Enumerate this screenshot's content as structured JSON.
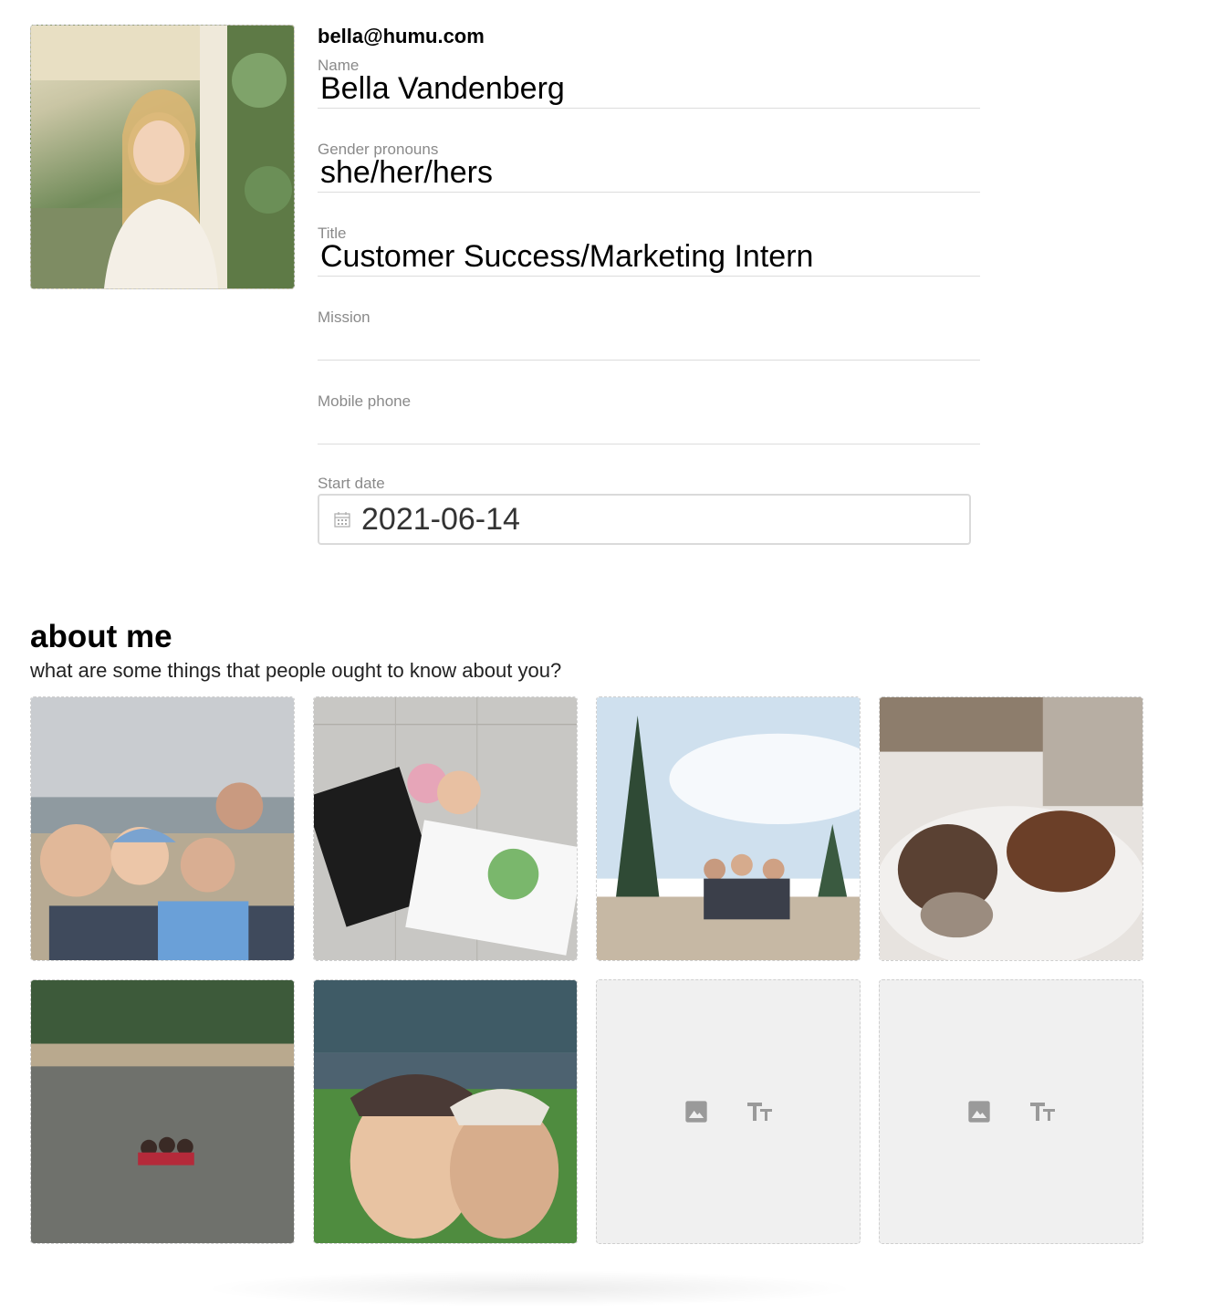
{
  "profile": {
    "email": "bella@humu.com",
    "fields": {
      "name": {
        "label": "Name",
        "value": "Bella Vandenberg"
      },
      "pronouns": {
        "label": "Gender pronouns",
        "value": "she/her/hers"
      },
      "title": {
        "label": "Title",
        "value": "Customer Success/Marketing Intern"
      },
      "mission": {
        "label": "Mission",
        "value": ""
      },
      "phone": {
        "label": "Mobile phone",
        "value": ""
      },
      "start_date": {
        "label": "Start date",
        "value": "2021-06-14"
      }
    }
  },
  "about": {
    "title": "about me",
    "subtitle": "what are some things that people ought to know about you?"
  },
  "tiles": [
    {
      "kind": "photo",
      "icon": "beach-group-photo"
    },
    {
      "kind": "photo",
      "icon": "city-hall-rally-photo"
    },
    {
      "kind": "photo",
      "icon": "mountain-hike-photo"
    },
    {
      "kind": "photo",
      "icon": "dogs-on-bed-photo"
    },
    {
      "kind": "photo",
      "icon": "lake-swim-photo"
    },
    {
      "kind": "photo",
      "icon": "ballpark-selfie-photo"
    },
    {
      "kind": "empty",
      "icons": [
        "image-icon",
        "text-icon"
      ]
    },
    {
      "kind": "empty",
      "icons": [
        "image-icon",
        "text-icon"
      ]
    }
  ],
  "colors": {
    "placeholder_bg": "#f0f0f0",
    "label_gray": "#8a8a8a",
    "divider": "#dcdcdc",
    "icon_gray": "#9a9a9a"
  }
}
